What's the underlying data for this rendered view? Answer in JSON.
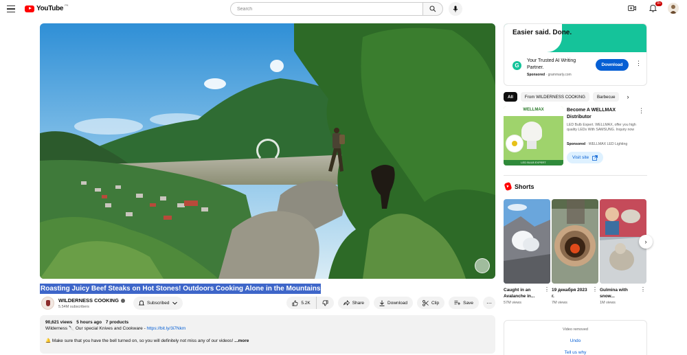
{
  "header": {
    "logo_text": "YouTube",
    "logo_sup": "PK",
    "search_placeholder": "Search",
    "notification_count": "9+"
  },
  "video": {
    "title": "Roasting Juicy Beef Steaks on Hot Stones! Outdoors Cooking Alone in the Mountains",
    "loading": true
  },
  "channel": {
    "name": "WILDERNESS COOKING",
    "subscribers": "5.54M subscribers",
    "subscribed_label": "Subscribed"
  },
  "actions": {
    "likes": "5.2K",
    "share": "Share",
    "download": "Download",
    "clip": "Clip",
    "save": "Save"
  },
  "description": {
    "views": "90,621 views",
    "age": "5 hours ago",
    "products": "7 products",
    "line1_prefix": "Wilderness 🔪 Our special Knives and Cookware - ",
    "line1_link": "https://bit.ly/3i7Nkm",
    "line2": "🔔 Make sure that you have the bell turned on, so you will definitely not miss any of our videos! ",
    "more": "...more"
  },
  "ad": {
    "tagline": "Easier said. Done.",
    "title": "Your Trusted AI Writing Partner.",
    "sponsored": "Sponsored",
    "domain": "grammarly.com",
    "cta": "Download",
    "logo_letter": "G"
  },
  "chips": [
    "All",
    "From WILDERNESS COOKING",
    "Barbecue"
  ],
  "promo": {
    "brand": "WELLMAX",
    "thumb_footer": "LED BULB EXPERT",
    "title": "Become A WELLMAX Distributor",
    "description": "LED Bulb Expert. WELLMAX, offer you high quality LEDs With SAMSUNG. Inquiry now",
    "sponsored": "Sponsored",
    "advertiser": "WELLMAX LED Lighting",
    "cta": "Visit site"
  },
  "shorts": {
    "heading": "Shorts",
    "items": [
      {
        "title": "Caught in an Avalanche in...",
        "views": "57M views"
      },
      {
        "title": "19 декабря 2023 г.",
        "views": "7M views"
      },
      {
        "title": "Gulmina with snow...",
        "views": "1M views"
      }
    ]
  },
  "removed": {
    "text": "Video removed",
    "undo": "Undo",
    "tell": "Tell us why"
  },
  "colors": {
    "brand_red": "#ff0000",
    "link_blue": "#065fd4",
    "grammarly_green": "#15c39a",
    "title_highlight": "#3e66c9"
  }
}
